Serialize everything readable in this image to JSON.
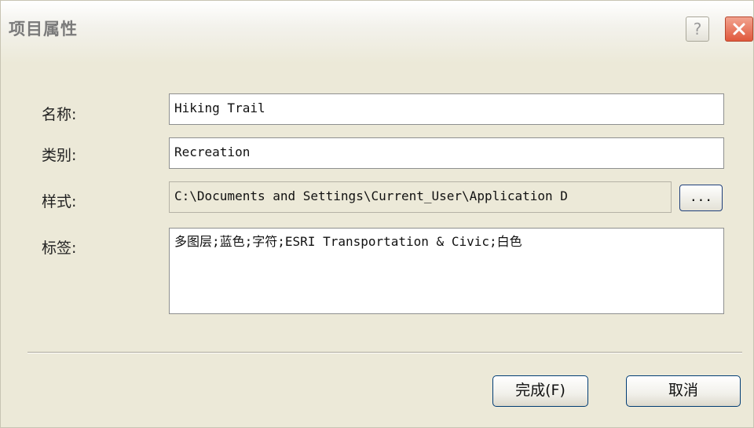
{
  "dialog": {
    "title": "项目属性",
    "help_label": "?",
    "close_label": "✕"
  },
  "fields": {
    "name_label": "名称:",
    "name_value": "Hiking Trail",
    "category_label": "类别:",
    "category_value": "Recreation",
    "style_label": "样式:",
    "style_value": "C:\\Documents and Settings\\Current_User\\Application D",
    "browse_label": "...",
    "tags_label": "标签:",
    "tags_value": "多图层;蓝色;字符;ESRI Transportation & Civic;白色"
  },
  "buttons": {
    "finish_label": "完成(F)",
    "cancel_label": "取消"
  },
  "colors": {
    "dialog_bg": "#ece9d8",
    "close_button": "#e0583c",
    "button_border": "#003c74"
  }
}
